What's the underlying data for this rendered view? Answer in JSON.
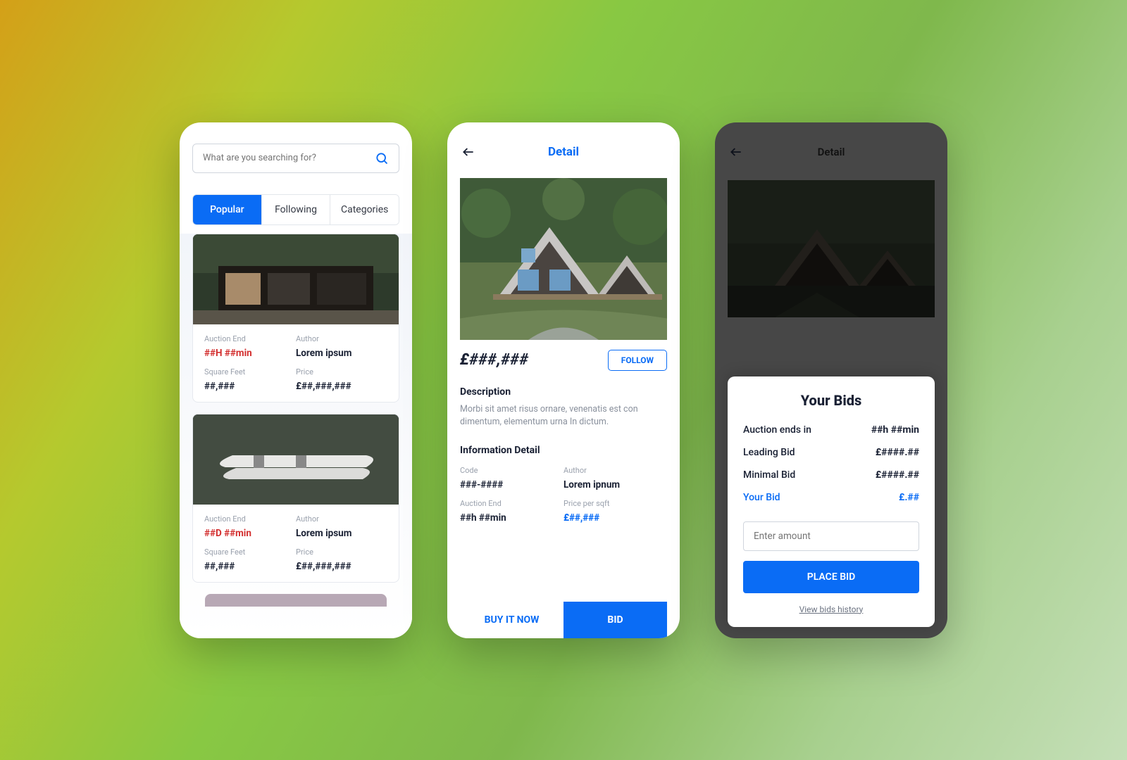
{
  "screen1": {
    "search_placeholder": "What are you searching for?",
    "tabs": [
      "Popular",
      "Following",
      "Categories"
    ],
    "cards": [
      {
        "auction_end_lbl": "Auction End",
        "auction_end": "##H ##min",
        "author_lbl": "Author",
        "author": "Lorem ipsum",
        "sqft_lbl": "Square Feet",
        "sqft": "##,###",
        "price_lbl": "Price",
        "price": "£##,###,###"
      },
      {
        "auction_end_lbl": "Auction End",
        "auction_end": "##D ##min",
        "author_lbl": "Author",
        "author": "Lorem ipsum",
        "sqft_lbl": "Square Feet",
        "sqft": "##,###",
        "price_lbl": "Price",
        "price": "£##,###,###"
      }
    ]
  },
  "screen2": {
    "title": "Detail",
    "price": "£###,###",
    "follow": "FOLLOW",
    "desc_h": "Description",
    "desc": "Morbi sit amet risus ornare, venenatis est con dimentum, elementum urna In dictum.",
    "info_h": "Information Detail",
    "code_lbl": "Code",
    "code": "###-####",
    "author_lbl": "Author",
    "author": "Lorem ipnum",
    "ae_lbl": "Auction End",
    "ae": "##h ##min",
    "pps_lbl": "Price per sqft",
    "pps": "£##,###",
    "buy": "BUY IT NOW",
    "bid": "BID"
  },
  "screen3": {
    "title": "Detail",
    "sheet_title": "Your Bids",
    "rows": [
      {
        "lbl": "Auction ends in",
        "val": "##h ##min"
      },
      {
        "lbl": "Leading Bid",
        "val": "£####.##"
      },
      {
        "lbl": "Minimal Bid",
        "val": "£####.##"
      },
      {
        "lbl": "Your Bid",
        "val": "£.##"
      }
    ],
    "amount_ph": "Enter amount",
    "place": "PLACE BID",
    "history": "View bids history"
  }
}
